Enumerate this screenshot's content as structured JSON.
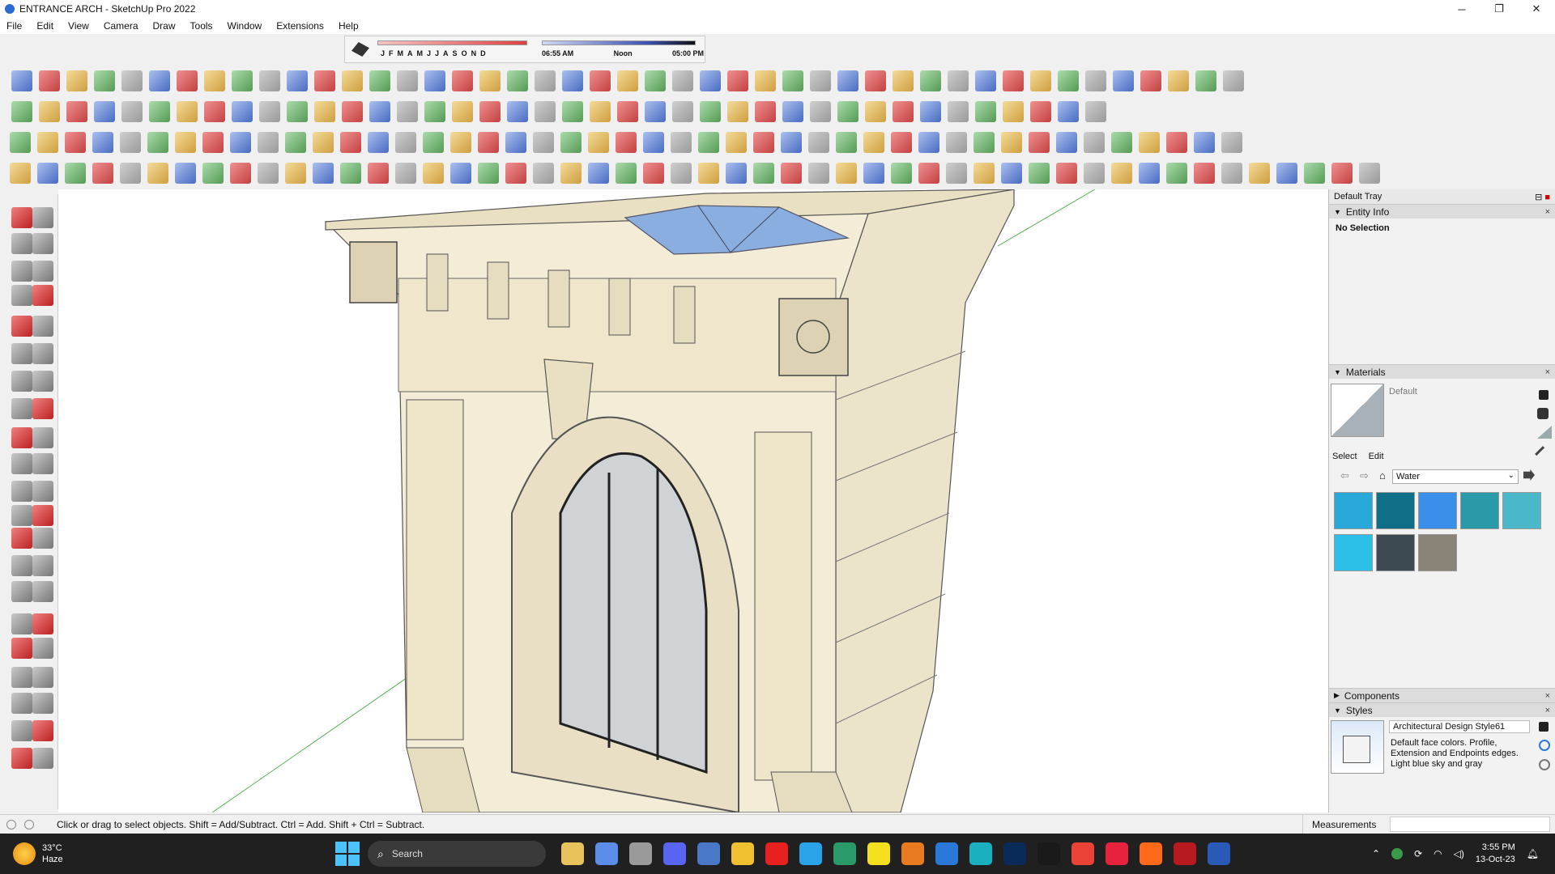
{
  "window": {
    "title": "ENTRANCE ARCH - SketchUp Pro 2022",
    "controls": [
      "─",
      "❐",
      "✕"
    ]
  },
  "menu": [
    "File",
    "Edit",
    "View",
    "Camera",
    "Draw",
    "Tools",
    "Window",
    "Extensions",
    "Help"
  ],
  "shadows": {
    "months": [
      "J",
      "F",
      "M",
      "A",
      "M",
      "J",
      "J",
      "A",
      "S",
      "O",
      "N",
      "D"
    ],
    "time_start": "06:55 AM",
    "time_mid": "Noon",
    "time_end": "05:00 PM"
  },
  "tray": {
    "title": "Default Tray",
    "entity_info": {
      "header": "Entity Info",
      "selection": "No Selection"
    },
    "materials": {
      "header": "Materials",
      "current": "Default",
      "tab_select": "Select",
      "tab_edit": "Edit",
      "library": "Water",
      "swatch_colors": [
        "#28a8d8",
        "#0e6f86",
        "#3a8fe8",
        "#2a9aa8",
        "#4ab8c8",
        "#2cc0e8",
        "#3e4a52",
        "#8a8478"
      ]
    },
    "components": {
      "header": "Components"
    },
    "styles": {
      "header": "Styles",
      "name": "Architectural Design Style61",
      "description": "Default face colors. Profile, Extension and Endpoints edges. Light blue sky and gray"
    }
  },
  "status": {
    "hint": "Click or drag to select objects. Shift = Add/Subtract. Ctrl = Add. Shift + Ctrl = Subtract.",
    "measurements_label": "Measurements",
    "measurements_value": ""
  },
  "taskbar": {
    "weather_temp": "33°C",
    "weather_desc": "Haze",
    "search_placeholder": "Search",
    "time": "3:55 PM",
    "date": "13-Oct-23",
    "app_colors": [
      "#e8c25a",
      "#5a8ee8",
      "#9a9a9a",
      "#5865f2",
      "#4a78c8",
      "#f0c030",
      "#e82020",
      "#2aa3e8",
      "#2a9a68",
      "#f5e020",
      "#e87a20",
      "#2a78d8",
      "#1ab0c0",
      "#0a2a5a",
      "#1a1a1a",
      "#ea4335",
      "#e6223c",
      "#ff6a1a",
      "#b81a20",
      "#2a5ab8"
    ]
  }
}
